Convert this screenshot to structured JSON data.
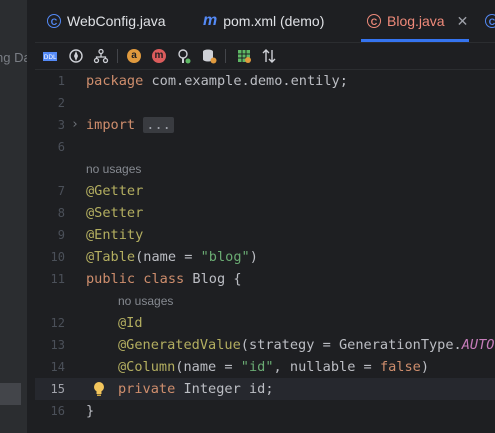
{
  "left_panel": {
    "cut_text": "ng Da"
  },
  "tabs": [
    {
      "label": "WebConfig.java",
      "icon": "java-class-icon",
      "active": false
    },
    {
      "label": "pom.xml (demo)",
      "icon": "maven-icon",
      "active": false
    },
    {
      "label": "Blog.java",
      "icon": "java-class-icon",
      "active": true,
      "close": "✕"
    },
    {
      "label": "",
      "icon": "java-class-icon",
      "active": false
    }
  ],
  "toolbar": [
    "ddl-icon",
    "compass-icon",
    "structure-icon",
    "annotation-a-icon",
    "annotation-m-icon",
    "bean-icon",
    "database-icon",
    "grid-icon",
    "sort-icon"
  ],
  "editor": {
    "lines": [
      {
        "n": "1",
        "text": "package com.example.demo.entily;"
      },
      {
        "n": "2",
        "text": ""
      },
      {
        "n": "3",
        "kw": "import",
        "folded": "..."
      },
      {
        "n": "6",
        "text": ""
      },
      {
        "hint": "no usages"
      },
      {
        "n": "7",
        "ann": "@Getter"
      },
      {
        "n": "8",
        "ann": "@Setter"
      },
      {
        "n": "9",
        "ann": "@Entity"
      },
      {
        "n": "10",
        "ann": "@Table",
        "rest1": "(name = ",
        "str": "\"blog\"",
        "rest2": ")"
      },
      {
        "n": "11",
        "kw": "public class",
        "rest": " Blog {"
      },
      {
        "hint": "no usages"
      },
      {
        "n": "12",
        "ann": "@Id"
      },
      {
        "n": "13",
        "ann": "@GeneratedValue",
        "rest1": "(strategy = GenerationType.",
        "enum": "AUTO",
        "rest2": ")"
      },
      {
        "n": "14",
        "ann": "@Column",
        "rest1": "(name = ",
        "str": "\"id\"",
        "rest2": ", nullable = ",
        "kw2": "false",
        "rest3": ")"
      },
      {
        "n": "15",
        "kw": "private",
        "rest": " Integer id;"
      },
      {
        "n": "16",
        "rest": "}"
      }
    ]
  }
}
